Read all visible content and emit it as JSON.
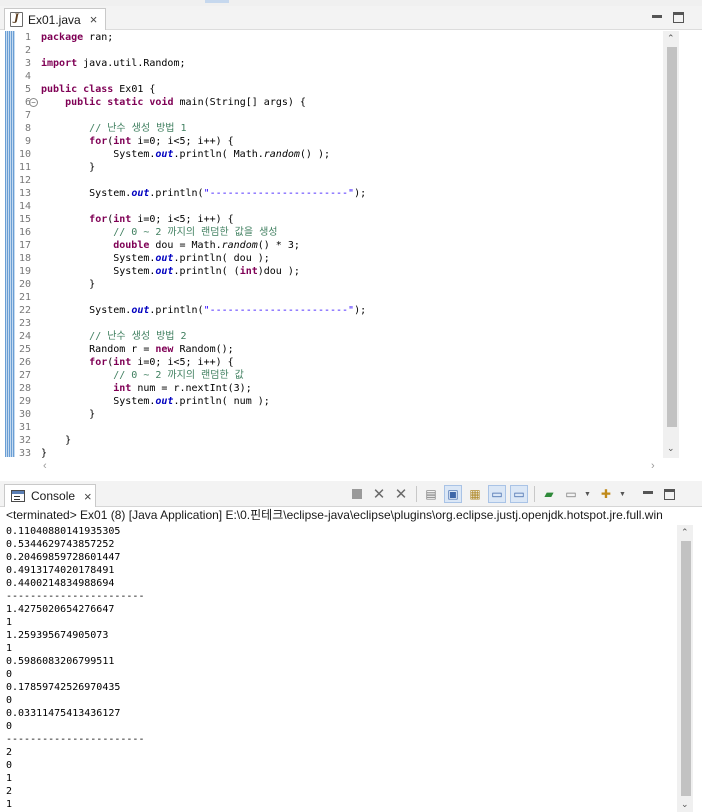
{
  "editor": {
    "tab_title": "Ex01.java",
    "tab_close": "×",
    "lines": [
      [
        [
          "kw",
          "package"
        ],
        [
          "",
          " ran;"
        ]
      ],
      [],
      [
        [
          "kw",
          "import"
        ],
        [
          "",
          " java.util.Random;"
        ]
      ],
      [],
      [
        [
          "kw",
          "public"
        ],
        [
          "",
          " "
        ],
        [
          "kw",
          "class"
        ],
        [
          "",
          " Ex01 {"
        ]
      ],
      [
        [
          "",
          "    "
        ],
        [
          "kw",
          "public"
        ],
        [
          "",
          " "
        ],
        [
          "kw",
          "static"
        ],
        [
          "",
          " "
        ],
        [
          "kw",
          "void"
        ],
        [
          "",
          " main(String[] args) {"
        ]
      ],
      [],
      [
        [
          "",
          "        "
        ],
        [
          "cm",
          "// 난수 생성 방법 1"
        ]
      ],
      [
        [
          "",
          "        "
        ],
        [
          "kw",
          "for"
        ],
        [
          "",
          "("
        ],
        [
          "kw",
          "int"
        ],
        [
          "",
          " i=0; i<5; i++) {"
        ]
      ],
      [
        [
          "",
          "            System."
        ],
        [
          "fd",
          "out"
        ],
        [
          "",
          ".println( Math."
        ],
        [
          "it",
          "random"
        ],
        [
          "",
          "() );"
        ]
      ],
      [
        [
          "",
          "        }"
        ]
      ],
      [],
      [
        [
          "",
          "        System."
        ],
        [
          "fd",
          "out"
        ],
        [
          "",
          ".println("
        ],
        [
          "st",
          "\"-----------------------\""
        ],
        [
          "",
          ");"
        ]
      ],
      [],
      [
        [
          "",
          "        "
        ],
        [
          "kw",
          "for"
        ],
        [
          "",
          "("
        ],
        [
          "kw",
          "int"
        ],
        [
          "",
          " i=0; i<5; i++) {"
        ]
      ],
      [
        [
          "",
          "            "
        ],
        [
          "cm",
          "// 0 ~ 2 까지의 랜덤한 값을 생성"
        ]
      ],
      [
        [
          "",
          "            "
        ],
        [
          "kw",
          "double"
        ],
        [
          "",
          " dou = Math."
        ],
        [
          "it",
          "random"
        ],
        [
          "",
          "() * 3;"
        ]
      ],
      [
        [
          "",
          "            System."
        ],
        [
          "fd",
          "out"
        ],
        [
          "",
          ".println( dou );"
        ]
      ],
      [
        [
          "",
          "            System."
        ],
        [
          "fd",
          "out"
        ],
        [
          "",
          ".println( ("
        ],
        [
          "kw",
          "int"
        ],
        [
          "",
          ")dou );"
        ]
      ],
      [
        [
          "",
          "        }"
        ]
      ],
      [],
      [
        [
          "",
          "        System."
        ],
        [
          "fd",
          "out"
        ],
        [
          "",
          ".println("
        ],
        [
          "st",
          "\"-----------------------\""
        ],
        [
          "",
          ");"
        ]
      ],
      [],
      [
        [
          "",
          "        "
        ],
        [
          "cm",
          "// 난수 생성 방법 2"
        ]
      ],
      [
        [
          "",
          "        Random r = "
        ],
        [
          "kw",
          "new"
        ],
        [
          "",
          " Random();"
        ]
      ],
      [
        [
          "",
          "        "
        ],
        [
          "kw",
          "for"
        ],
        [
          "",
          "("
        ],
        [
          "kw",
          "int"
        ],
        [
          "",
          " i=0; i<5; i++) {"
        ]
      ],
      [
        [
          "",
          "            "
        ],
        [
          "cm",
          "// 0 ~ 2 까지의 랜덤한 값"
        ]
      ],
      [
        [
          "",
          "            "
        ],
        [
          "kw",
          "int"
        ],
        [
          "",
          " num = r.nextInt(3);"
        ]
      ],
      [
        [
          "",
          "            System."
        ],
        [
          "fd",
          "out"
        ],
        [
          "",
          ".println( num );"
        ]
      ],
      [
        [
          "",
          "        }"
        ]
      ],
      [],
      [
        [
          "",
          "    }"
        ]
      ],
      [
        [
          "",
          "}"
        ]
      ]
    ]
  },
  "console": {
    "tab_title": "Console",
    "tab_close": "×",
    "status": "<terminated> Ex01 (8) [Java Application] E:\\0.핀테크\\eclipse-java\\eclipse\\plugins\\org.eclipse.justj.openjdk.hotspot.jre.full.win",
    "output": [
      "0.11040880141935305",
      "0.5344629743857252",
      "0.20469859728601447",
      "0.4913174020178491",
      "0.4400214834988694",
      "-----------------------",
      "1.4275020654276647",
      "1",
      "1.259395674905073",
      "1",
      "0.5986083206799511",
      "0",
      "0.17859742526970435",
      "0",
      "0.03311475413436127",
      "0",
      "-----------------------",
      "2",
      "0",
      "1",
      "2",
      "1"
    ]
  },
  "colors": {
    "keyword": "#7f0055",
    "comment": "#3f7f5f",
    "string": "#2a00ff",
    "field": "#0000c0"
  }
}
